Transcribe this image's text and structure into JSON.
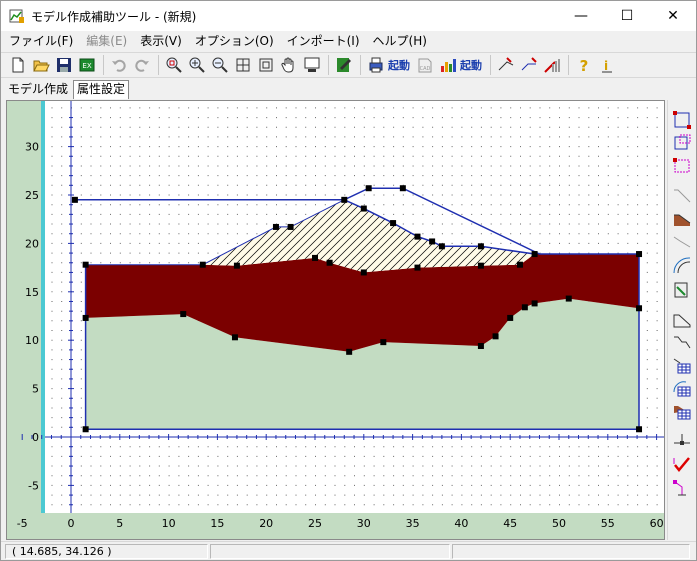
{
  "window": {
    "title": "モデル作成補助ツール - (新規)",
    "minimize_glyph": "—",
    "maximize_glyph": "☐",
    "close_glyph": "✕"
  },
  "menu": [
    {
      "label": "ファイル(F)",
      "enabled": true
    },
    {
      "label": "編集(E)",
      "enabled": false
    },
    {
      "label": "表示(V)",
      "enabled": true
    },
    {
      "label": "オプション(O)",
      "enabled": true
    },
    {
      "label": "インポート(I)",
      "enabled": true
    },
    {
      "label": "ヘルプ(H)",
      "enabled": true
    }
  ],
  "toolbar": {
    "launch1_label": "起動",
    "launch2_label": "起動",
    "launch3_label": "起動"
  },
  "tabs": [
    {
      "label": "モデル作成",
      "active": false
    },
    {
      "label": "属性設定",
      "active": true
    }
  ],
  "status": {
    "coords": "( 14.685,  34.126 )",
    "cell2": "",
    "cell3": ""
  },
  "colors": {
    "grass": "#c3dcc2",
    "clay": "#7b0000",
    "outline": "#1f2fb0",
    "axis_strip": "#4cc9d2",
    "hatch_fill": "#fffbe8"
  },
  "plot": {
    "xlim": [
      -5,
      61
    ],
    "ylim": [
      -8,
      34
    ],
    "x_ticks": [
      "-5",
      "0",
      "5",
      "10",
      "15",
      "20",
      "25",
      "30",
      "35",
      "40",
      "45",
      "50",
      "55",
      "60"
    ],
    "y_ticks": [
      "30",
      "25",
      "20",
      "15",
      "10",
      "5",
      "0",
      "-5"
    ],
    "outer_boundary": [
      [
        1.5,
        17.8
      ],
      [
        1.5,
        0.8
      ],
      [
        58.2,
        0.8
      ],
      [
        58.2,
        18.9
      ]
    ],
    "ground_line": [
      [
        0.4,
        24.5
      ],
      [
        28,
        24.5
      ],
      [
        30.5,
        25.7
      ],
      [
        34,
        25.7
      ],
      [
        48,
        18.9
      ],
      [
        58.2,
        18.9
      ]
    ],
    "inner_line": [
      [
        28,
        24.5
      ],
      [
        30,
        23.6
      ],
      [
        33,
        22.1
      ],
      [
        35.5,
        20.7
      ],
      [
        37,
        20.2
      ],
      [
        38,
        19.7
      ],
      [
        42,
        19.7
      ],
      [
        47.5,
        18.9
      ]
    ],
    "fill_region": [
      [
        13.5,
        17.8
      ],
      [
        21,
        21.7
      ],
      [
        22.5,
        21.7
      ],
      [
        28,
        24.5
      ],
      [
        30,
        23.6
      ],
      [
        33,
        22.1
      ],
      [
        35.5,
        20.7
      ],
      [
        37,
        20.2
      ],
      [
        38,
        19.7
      ],
      [
        42,
        19.7
      ],
      [
        47.5,
        18.9
      ],
      [
        46,
        17.8
      ],
      [
        42,
        17.7
      ],
      [
        35.5,
        17.5
      ],
      [
        30,
        17
      ],
      [
        26.5,
        18
      ],
      [
        25,
        18.5
      ],
      [
        17,
        17.7
      ],
      [
        13.5,
        17.8
      ]
    ],
    "clay_top": [
      [
        1.5,
        17.8
      ],
      [
        13.5,
        17.8
      ],
      [
        17,
        17.7
      ],
      [
        25,
        18.5
      ],
      [
        26.5,
        18
      ],
      [
        30,
        17
      ],
      [
        35.5,
        17.5
      ],
      [
        42,
        17.7
      ],
      [
        46,
        17.8
      ],
      [
        47.5,
        18.9
      ],
      [
        58.2,
        18.9
      ]
    ],
    "clay_bottom": [
      [
        1.5,
        12.3
      ],
      [
        11.5,
        12.7
      ],
      [
        16.8,
        10.3
      ],
      [
        28.5,
        8.8
      ],
      [
        32,
        9.8
      ],
      [
        42,
        9.4
      ],
      [
        43.5,
        10.4
      ],
      [
        45,
        12.3
      ],
      [
        46.5,
        13.4
      ],
      [
        47.5,
        13.8
      ],
      [
        51,
        14.3
      ],
      [
        58.2,
        13.3
      ]
    ],
    "points": [
      [
        0.4,
        24.5
      ],
      [
        1.5,
        17.8
      ],
      [
        1.5,
        12.3
      ],
      [
        1.5,
        0.8
      ],
      [
        58.2,
        0.8
      ],
      [
        58.2,
        13.3
      ],
      [
        58.2,
        18.9
      ],
      [
        11.5,
        12.7
      ],
      [
        13.5,
        17.8
      ],
      [
        16.8,
        10.3
      ],
      [
        17,
        17.7
      ],
      [
        21,
        21.7
      ],
      [
        22.5,
        21.7
      ],
      [
        25,
        18.5
      ],
      [
        26.5,
        18
      ],
      [
        28,
        24.5
      ],
      [
        28.5,
        8.8
      ],
      [
        30,
        23.6
      ],
      [
        30,
        17
      ],
      [
        30.5,
        25.7
      ],
      [
        32,
        9.8
      ],
      [
        33,
        22.1
      ],
      [
        34,
        25.7
      ],
      [
        35.5,
        20.7
      ],
      [
        35.5,
        17.5
      ],
      [
        37,
        20.2
      ],
      [
        38,
        19.7
      ],
      [
        42,
        19.7
      ],
      [
        42,
        17.7
      ],
      [
        42,
        9.4
      ],
      [
        43.5,
        10.4
      ],
      [
        45,
        12.3
      ],
      [
        46,
        17.8
      ],
      [
        46.5,
        13.4
      ],
      [
        47.5,
        13.8
      ],
      [
        47.5,
        18.9
      ],
      [
        51,
        14.3
      ]
    ]
  }
}
